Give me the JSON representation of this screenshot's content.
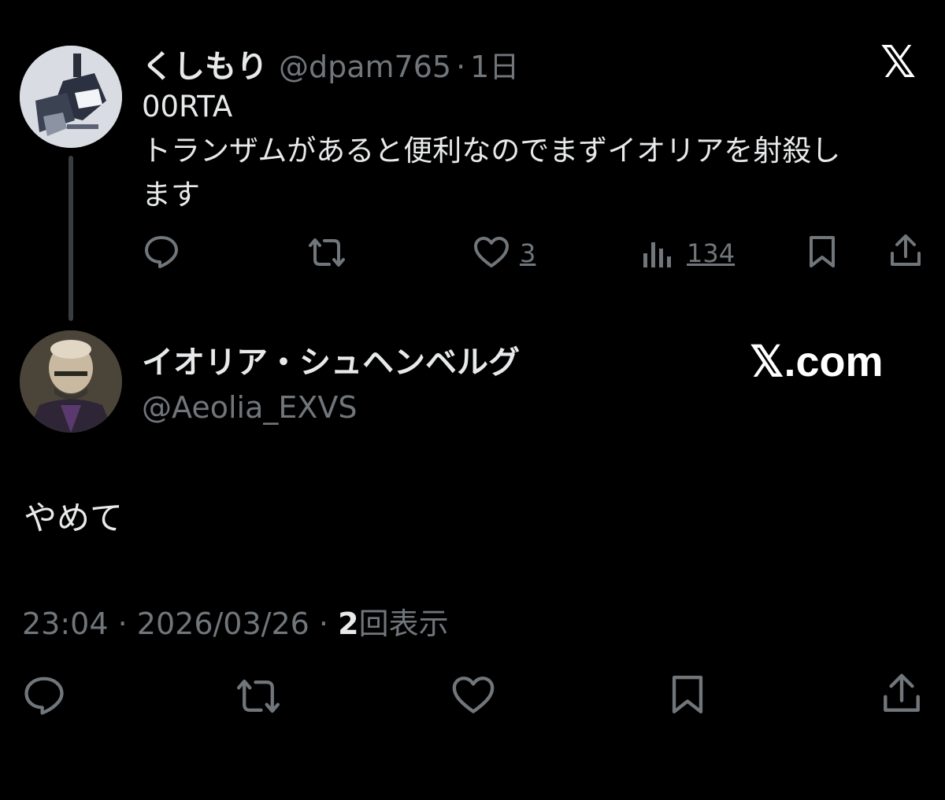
{
  "parent_tweet": {
    "display_name": "くしもり",
    "handle": "@dpam765",
    "separator": "·",
    "time_ago": "1日",
    "text_lines": [
      "00RTA",
      "トランザムがあると便利なのでまずイオリアを射殺し",
      "ます"
    ],
    "actions": {
      "reply_icon": "reply-bubble-icon",
      "retweet_icon": "retweet-icon",
      "like_icon": "heart-icon",
      "like_count": "3",
      "views_icon": "bar-chart-icon",
      "view_count": "134",
      "bookmark_icon": "bookmark-icon",
      "share_icon": "share-upload-icon"
    }
  },
  "reply_tweet": {
    "display_name": "イオリア・シュヘンベルグ",
    "handle": "@Aeolia_EXVS",
    "body": "やめて",
    "time": "23:04",
    "separator": "·",
    "date": "2026/03/26",
    "separator2": "·",
    "view_count": "2",
    "view_label": "回表示"
  },
  "branding": {
    "x_logo": "𝕏",
    "x_com": "𝕏.com"
  },
  "colors": {
    "background": "#000000",
    "text_primary": "#e7e9ea",
    "text_muted": "#71767b"
  }
}
